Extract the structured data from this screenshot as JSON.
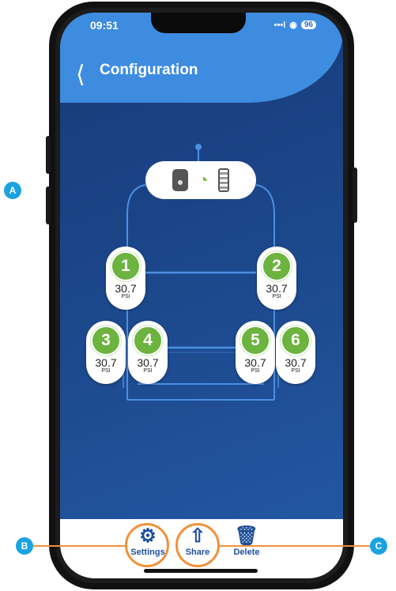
{
  "status": {
    "time": "09:51",
    "signal": "•••l",
    "wifi": "◉",
    "battery": "96"
  },
  "header": {
    "title": "Configuration"
  },
  "sensors": [
    {
      "id": "1",
      "value": "30.7",
      "unit": "PSI"
    },
    {
      "id": "2",
      "value": "30.7",
      "unit": "PSI"
    },
    {
      "id": "3",
      "value": "30.7",
      "unit": "PSI"
    },
    {
      "id": "4",
      "value": "30.7",
      "unit": "PSI"
    },
    {
      "id": "5",
      "value": "30.7",
      "unit": "PSI"
    },
    {
      "id": "6",
      "value": "30.7",
      "unit": "PSI"
    }
  ],
  "gateway": {
    "icons": [
      "hub-icon",
      "wifi-icon",
      "battery-icon"
    ]
  },
  "bottom_nav": {
    "settings": "Settings",
    "share": "Share",
    "delete": "Delete"
  },
  "callouts": {
    "a": "A",
    "b": "B",
    "c": "C"
  },
  "colors": {
    "header": "#3d8ce0",
    "sensor_badge": "#6cb33f",
    "callout": "#1aa3e0",
    "highlight": "#f0913a"
  }
}
